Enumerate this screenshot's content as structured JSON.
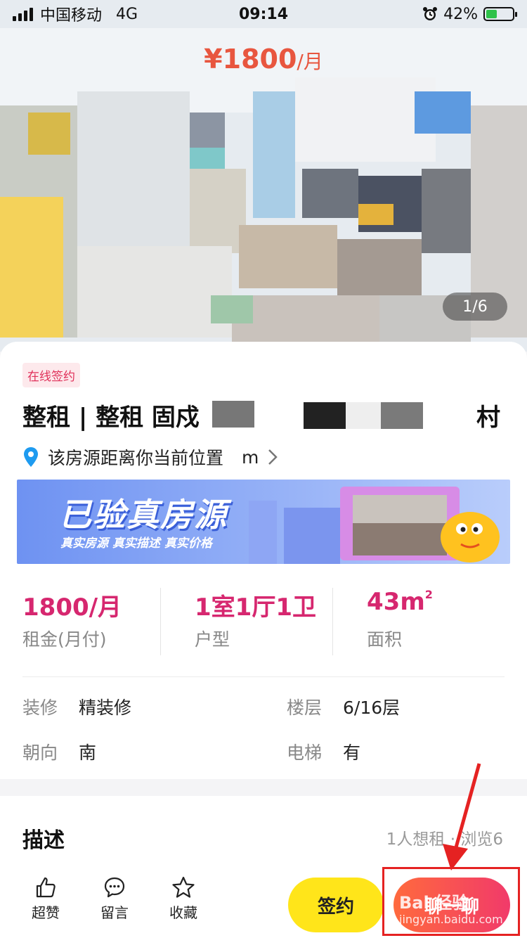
{
  "status_bar": {
    "carrier": "中国移动",
    "network": "4G",
    "time": "09:14",
    "battery": "42%",
    "battery_level": 0.42
  },
  "hero": {
    "currency": "¥",
    "price": "1800",
    "unit": "/月",
    "photo_counter": "1/6"
  },
  "listing": {
    "tag": "在线签约",
    "title_visible": "整租 | 整租  固戍",
    "title_tail": "村",
    "distance_prefix": "该房源距离你当前位置",
    "distance_unit": "m"
  },
  "banner": {
    "title": "已验真房源",
    "subtitle": "真实房源 真实描述 真实价格"
  },
  "stats": [
    {
      "value": "1800/月",
      "label": "租金(月付)"
    },
    {
      "value": "1室1厅1卫",
      "label": "户型"
    },
    {
      "value": "43m",
      "sup": "2",
      "label": "面积"
    }
  ],
  "attributes": [
    {
      "key": "装修",
      "value": "精装修"
    },
    {
      "key": "楼层",
      "value": "6/16层"
    },
    {
      "key": "朝向",
      "value": "南"
    },
    {
      "key": "电梯",
      "value": "有"
    }
  ],
  "description": {
    "title": "描述",
    "meta": "1人想租 · 浏览6"
  },
  "bottom_bar": {
    "like_label": "超赞",
    "comment_label": "留言",
    "favorite_label": "收藏",
    "sign_label": "签约",
    "chat_label": "聊一聊"
  },
  "watermark": {
    "text": "Bai 经验",
    "sub": "jingyan.baidu.com"
  },
  "colors": {
    "accent": "#d6276f",
    "price": "#e8563f",
    "sign": "#ffe51a",
    "chat": "#f13a6a",
    "highlight": "#e52222"
  }
}
